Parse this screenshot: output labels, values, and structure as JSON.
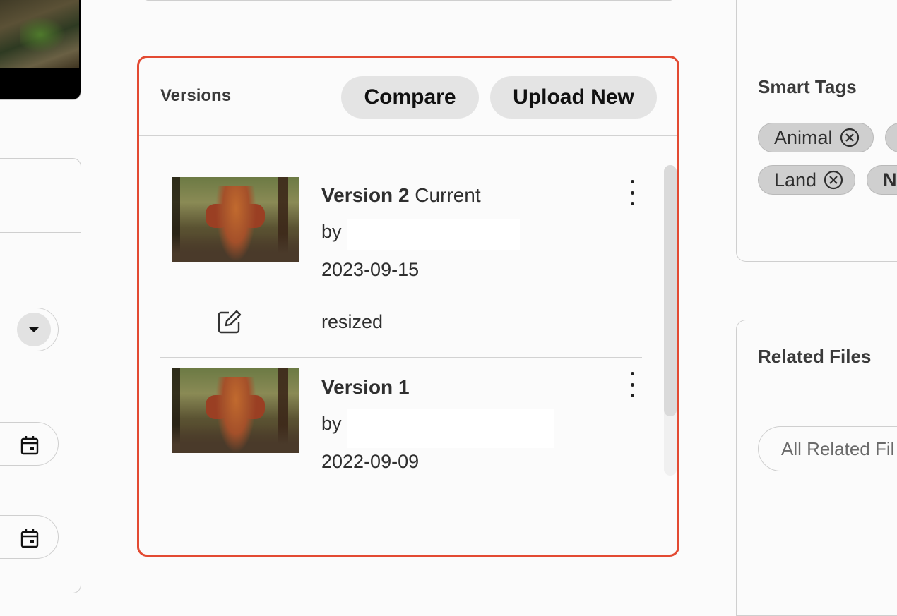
{
  "versions_panel": {
    "title": "Versions",
    "compare_label": "Compare",
    "upload_label": "Upload New",
    "items": [
      {
        "name": "Version 2",
        "badge": "Current",
        "by_label": "by",
        "date": "2023-09-15",
        "comment": "resized"
      },
      {
        "name": "Version 1",
        "badge": "",
        "by_label": "by",
        "date": "2022-09-09",
        "comment": ""
      }
    ]
  },
  "smart_tags": {
    "title": "Smart Tags",
    "tags": [
      "Animal",
      "Land"
    ],
    "partial_tags": [
      "",
      "N"
    ]
  },
  "related_files": {
    "title": "Related Files",
    "filter_placeholder": "All Related Fil"
  },
  "colors": {
    "panel_highlight": "#e34a32",
    "button_bg": "#e4e4e4",
    "tag_bg": "#cfcfcf"
  },
  "icons": {
    "edit": "edit-square-icon",
    "more": "kebab-vertical-icon",
    "calendar": "calendar-icon",
    "remove_tag": "circle-x-icon",
    "dropdown": "caret-down-icon"
  }
}
